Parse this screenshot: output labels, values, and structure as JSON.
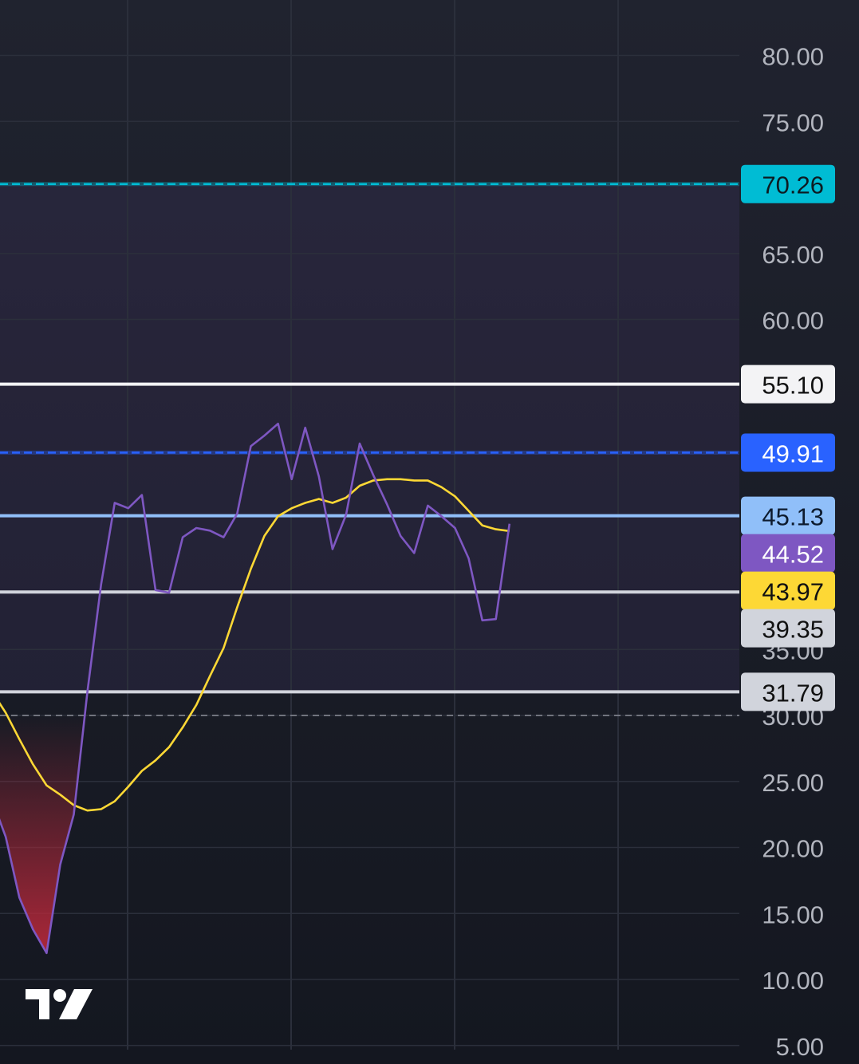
{
  "chart_data": {
    "type": "line",
    "title": "",
    "xlabel": "",
    "ylabel": "",
    "y_axis": {
      "ylim": [
        3,
        84
      ],
      "ticks": [
        "80.00",
        "75.00",
        "65.00",
        "60.00",
        "35.00",
        "30.00",
        "25.00",
        "20.00",
        "15.00",
        "10.00",
        "5.00"
      ],
      "position": "right"
    },
    "grid": true,
    "levels": [
      {
        "label": "70.26",
        "value": 70.26,
        "color": "#00bcd4",
        "text_color": "#0d1b22",
        "style": "dashed"
      },
      {
        "label": "55.10",
        "value": 55.1,
        "color": "#f3f3f5",
        "text_color": "#111111",
        "style": "solid"
      },
      {
        "label": "49.91",
        "value": 49.91,
        "color": "#2962ff",
        "text_color": "#ffffff",
        "style": "dashed"
      },
      {
        "label": "45.13",
        "value": 45.13,
        "color": "#90bff9",
        "text_color": "#0d1b2e",
        "style": "solid"
      },
      {
        "label": "39.35",
        "value": 39.35,
        "color": "#d1d4dc",
        "text_color": "#111111",
        "style": "solid"
      },
      {
        "label": "31.79",
        "value": 31.79,
        "color": "#d1d4dc",
        "text_color": "#111111",
        "style": "solid"
      }
    ],
    "value_labels": [
      {
        "label": "44.52",
        "value": 44.52,
        "color": "#7e57c2",
        "text_color": "#ffffff"
      },
      {
        "label": "43.97",
        "value": 43.97,
        "color": "#fdd835",
        "text_color": "#111111"
      }
    ],
    "band": {
      "from": 31.79,
      "to": 70.26,
      "color": "#7e57c2"
    },
    "midline": {
      "value": 30
    },
    "series": [
      {
        "color": "#7e57c2",
        "values": [
          [
            -1,
            23.6
          ],
          [
            0,
            20.8
          ],
          [
            1,
            16.2
          ],
          [
            2,
            13.8
          ],
          [
            3,
            12.0
          ],
          [
            4,
            18.7
          ],
          [
            5,
            22.5
          ],
          [
            6,
            31.8
          ],
          [
            7,
            39.9
          ],
          [
            8,
            46.1
          ],
          [
            9,
            45.7
          ],
          [
            10,
            46.7
          ],
          [
            11,
            39.5
          ],
          [
            12,
            39.3
          ],
          [
            13,
            43.5
          ],
          [
            14,
            44.2
          ],
          [
            15,
            44.0
          ],
          [
            16,
            43.5
          ],
          [
            17,
            45.3
          ],
          [
            18,
            50.4
          ],
          [
            19,
            51.2
          ],
          [
            20,
            52.1
          ],
          [
            21,
            47.9
          ],
          [
            22,
            51.8
          ],
          [
            23,
            48.1
          ],
          [
            24,
            42.6
          ],
          [
            25,
            45.2
          ],
          [
            26,
            50.6
          ],
          [
            27,
            48.2
          ],
          [
            28,
            46.0
          ],
          [
            29,
            43.6
          ],
          [
            30,
            42.3
          ],
          [
            31,
            45.9
          ],
          [
            32,
            45.1
          ],
          [
            33,
            44.2
          ],
          [
            34,
            41.9
          ],
          [
            35,
            37.2
          ],
          [
            36,
            37.3
          ],
          [
            37,
            44.52
          ]
        ]
      },
      {
        "color": "#fdd835",
        "values": [
          [
            -1,
            31.8
          ],
          [
            0,
            30.2
          ],
          [
            1,
            28.2
          ],
          [
            2,
            26.3
          ],
          [
            3,
            24.7
          ],
          [
            4,
            24.0
          ],
          [
            5,
            23.2
          ],
          [
            6,
            22.8
          ],
          [
            7,
            22.9
          ],
          [
            8,
            23.5
          ],
          [
            9,
            24.6
          ],
          [
            10,
            25.8
          ],
          [
            11,
            26.6
          ],
          [
            12,
            27.6
          ],
          [
            13,
            29.1
          ],
          [
            14,
            30.8
          ],
          [
            15,
            33.0
          ],
          [
            16,
            35.1
          ],
          [
            17,
            38.2
          ],
          [
            18,
            41.1
          ],
          [
            19,
            43.6
          ],
          [
            20,
            45.1
          ],
          [
            21,
            45.7
          ],
          [
            22,
            46.1
          ],
          [
            23,
            46.4
          ],
          [
            24,
            46.1
          ],
          [
            25,
            46.5
          ],
          [
            26,
            47.4
          ],
          [
            27,
            47.8
          ],
          [
            28,
            47.9
          ],
          [
            29,
            47.9
          ],
          [
            30,
            47.8
          ],
          [
            31,
            47.8
          ],
          [
            32,
            47.3
          ],
          [
            33,
            46.6
          ],
          [
            34,
            45.5
          ],
          [
            35,
            44.4
          ],
          [
            36,
            44.1
          ],
          [
            37,
            43.97
          ]
        ]
      }
    ],
    "oversold_fill": {
      "color": "#b3283a"
    }
  },
  "watermark": {
    "icon": "tradingview-logo-icon"
  }
}
